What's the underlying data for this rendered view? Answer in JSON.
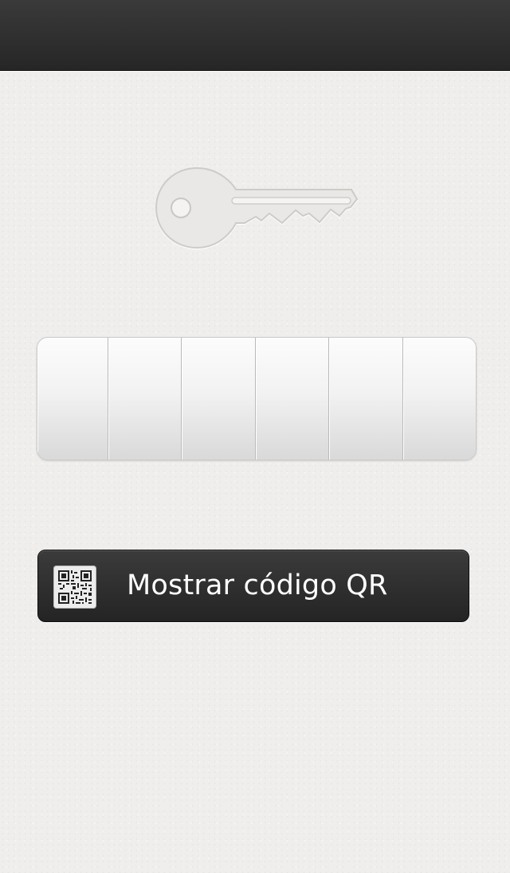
{
  "header": {
    "title": ""
  },
  "key_icon": "key-icon",
  "code": {
    "digits": [
      "",
      "",
      "",
      "",
      "",
      ""
    ]
  },
  "qr_button": {
    "label": "Mostrar código QR",
    "icon": "qr-code-icon"
  },
  "colors": {
    "top_bar": "#2e2e2e",
    "background": "#efeeec",
    "button": "#2f2f2f",
    "button_text": "#ffffff"
  }
}
